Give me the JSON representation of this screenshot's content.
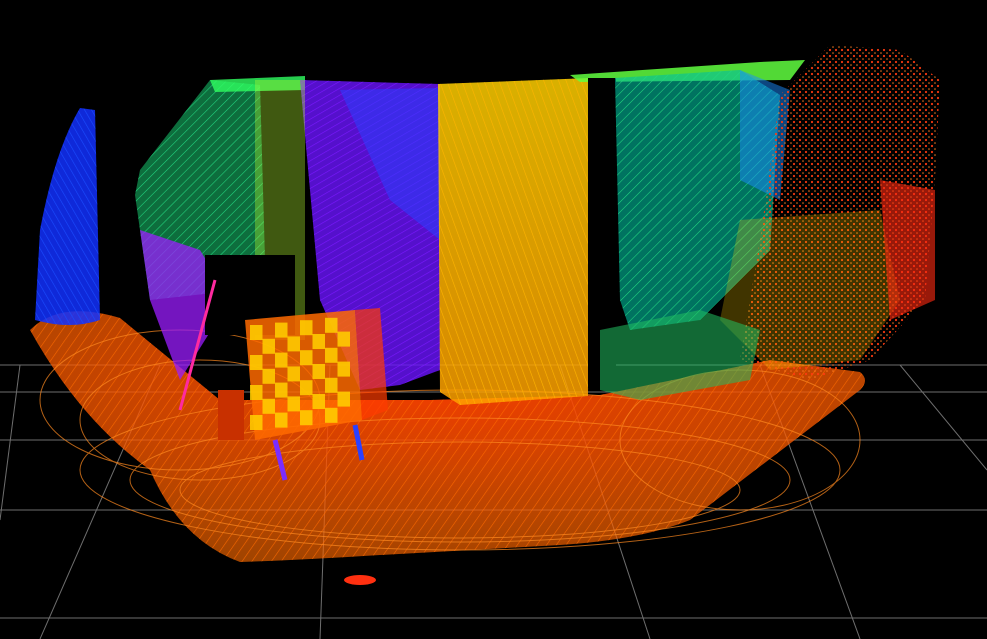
{
  "scene": {
    "view": "3d-point-cloud-viewport",
    "background": "#000000",
    "grid_color": "#8a8a8a",
    "color_scale": [
      "#ff2a00",
      "#ff7a00",
      "#ffd000",
      "#c8ff00",
      "#30ff60",
      "#00e8c0",
      "#1a60ff",
      "#3a2cff",
      "#9b1cff",
      "#ff00c8"
    ],
    "objects": [
      "ground-grid",
      "floor-scan",
      "left-wall-scan",
      "back-left-wall-scan",
      "purple-wall-scan",
      "yellow-door-scan",
      "teal-wall-scan",
      "right-cluttered-scan",
      "checkerboard-target",
      "tripod-stand"
    ]
  }
}
